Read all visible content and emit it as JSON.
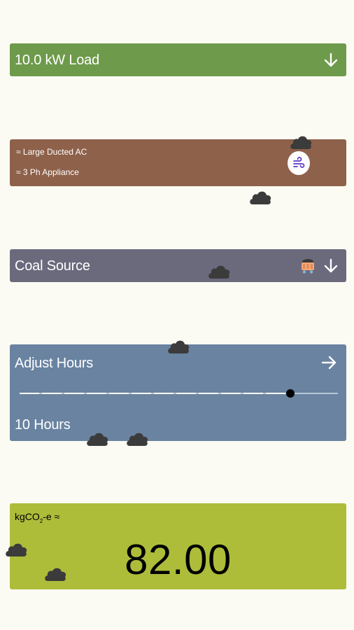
{
  "load": {
    "label": "10.0 kW Load",
    "icon": "arrow-down-icon"
  },
  "appliance": {
    "line1": "≈ Large Ducted AC",
    "line2": "≈ 3 Ph Appliance",
    "icon": "airflow-icon"
  },
  "source": {
    "label": "Coal Source",
    "icons": [
      "coal-cart-icon",
      "arrow-down-icon"
    ]
  },
  "hours": {
    "title": "Adjust Hours",
    "value_label": "10 Hours",
    "slider_fraction": 0.85,
    "icon": "arrow-right-icon"
  },
  "carbon": {
    "unit": "kgCO",
    "unit_sub": "2",
    "unit_suffix": "-e ≈",
    "value": "82.00"
  },
  "colors": {
    "background": "#fbfbf3",
    "load": "#6e9a4b",
    "appliance": "#8e614a",
    "source": "#6b6a7d",
    "hours": "#6983a1",
    "carbon": "#adbd3a",
    "cloud": "#3b3b3b"
  }
}
